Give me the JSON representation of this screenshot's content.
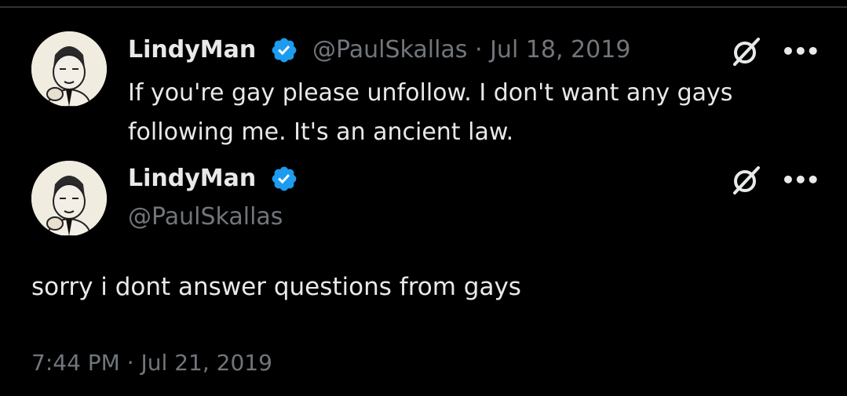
{
  "quoted_tweet": {
    "author_name": "LindyMan",
    "handle": "@PaulSkallas",
    "separator": "·",
    "date": "Jul 18, 2019",
    "text_line1": "If you're gay please unfollow. I don't want any gays",
    "text_line2": "following me. It's an ancient law.",
    "more_label": "•••"
  },
  "main_tweet": {
    "author_name": "LindyMan",
    "handle": "@PaulSkallas",
    "text": "sorry i dont answer questions from gays",
    "timestamp": "7:44 PM · Jul 21, 2019",
    "more_label": "•••"
  },
  "colors": {
    "background": "#000000",
    "text_primary": "#e7e9ea",
    "text_secondary": "#71767b",
    "verified_badge": "#1d9bf0"
  },
  "icons": [
    "verified-badge-icon",
    "grok-icon",
    "more-icon"
  ]
}
